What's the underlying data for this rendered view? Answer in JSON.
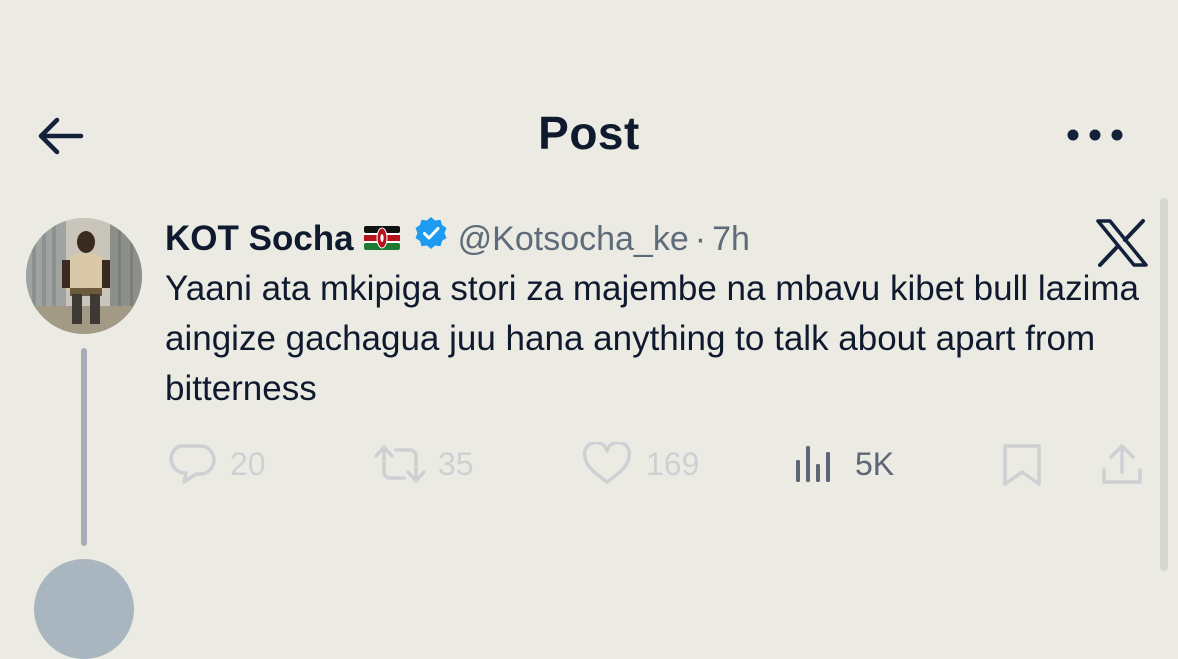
{
  "header": {
    "title": "Post"
  },
  "tweet": {
    "display_name": "KOT Socha",
    "flag_icon": "kenya-flag-icon",
    "verified_icon": "verified-badge-icon",
    "handle": "@Kotsocha_ke",
    "separator": "·",
    "time": "7h",
    "text": "Yaani ata mkipiga stori za majembe na mbavu kibet bull lazima aingize gachagua juu hana anything to talk about apart from bitterness",
    "platform_icon": "x-logo-icon"
  },
  "actions": {
    "replies": "20",
    "reposts": "35",
    "likes": "169",
    "views": "5K"
  },
  "colors": {
    "background": "#ebebe4",
    "text": "#0f1a2e",
    "secondary_text": "#5e6b79",
    "verified": "#1d9bf0",
    "muted_action": "#ced0d3"
  }
}
